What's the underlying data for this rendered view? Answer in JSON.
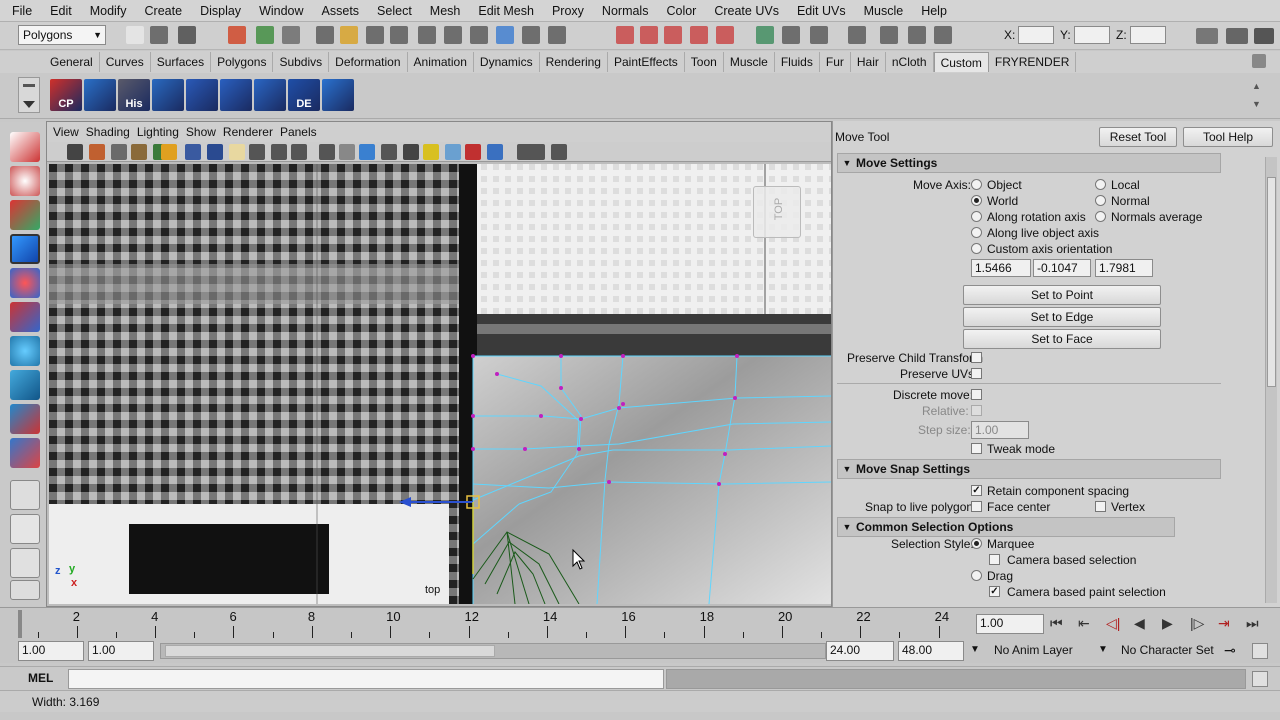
{
  "menus": [
    "File",
    "Edit",
    "Modify",
    "Create",
    "Display",
    "Window",
    "Assets",
    "Select",
    "Mesh",
    "Edit Mesh",
    "Proxy",
    "Normals",
    "Color",
    "Create UVs",
    "Edit UVs",
    "Muscle",
    "Help"
  ],
  "status_line": {
    "menu_set": "Polygons",
    "x_label": "X:",
    "y_label": "Y:",
    "z_label": "Z:"
  },
  "shelf_tabs": [
    "General",
    "Curves",
    "Surfaces",
    "Polygons",
    "Subdivs",
    "Deformation",
    "Animation",
    "Dynamics",
    "Rendering",
    "PaintEffects",
    "Toon",
    "Muscle",
    "Fluids",
    "Fur",
    "Hair",
    "nCloth",
    "Custom",
    "FRYRENDER"
  ],
  "shelf_active_tab": "Custom",
  "shelf_buttons": [
    {
      "label": "CP",
      "color": "#d0302a"
    },
    {
      "label": "",
      "color": "#2a70c8"
    },
    {
      "label": "His",
      "color": "#5a5a6a"
    },
    {
      "label": "",
      "color": "#2a6ac0"
    },
    {
      "label": "",
      "color": "#2a5ab8"
    },
    {
      "label": "",
      "color": "#2a60c0"
    },
    {
      "label": "",
      "color": "#2a66c4"
    },
    {
      "label": "DE",
      "color": "#1f4fa8"
    },
    {
      "label": "",
      "color": "#2a72d0"
    }
  ],
  "viewport": {
    "menus": [
      "View",
      "Shading",
      "Lighting",
      "Show",
      "Renderer",
      "Panels"
    ],
    "camera_label": "top",
    "view_cube_label": "TOP",
    "axis_z": "z",
    "axis_y": "y",
    "axis_x": "x"
  },
  "tool_settings": {
    "title": "Move Tool",
    "reset_button": "Reset Tool",
    "help_button": "Tool Help",
    "move_settings": {
      "header": "Move Settings",
      "move_axis_label": "Move Axis:",
      "options_left": [
        "Object",
        "World",
        "Along rotation axis",
        "Along live object axis",
        "Custom axis orientation"
      ],
      "options_right": [
        "Local",
        "Normal",
        "Normals average"
      ],
      "selected": "World",
      "values": [
        "1.5466",
        "-0.1047",
        "1.7981"
      ],
      "set_to_point": "Set to Point",
      "set_to_edge": "Set to Edge",
      "set_to_face": "Set to Face",
      "preserve_child": "Preserve Child Transform",
      "preserve_uvs": "Preserve UVs",
      "discrete_move": "Discrete move:",
      "relative": "Relative:",
      "step_size_label": "Step size:",
      "step_size": "1.00",
      "tweak_mode": "Tweak mode"
    },
    "snap_settings": {
      "header": "Move Snap Settings",
      "retain_spacing": "Retain component spacing",
      "snap_label": "Snap to live polygon:",
      "face_center": "Face center",
      "vertex": "Vertex"
    },
    "selection_options": {
      "header": "Common Selection Options",
      "style_label": "Selection Style:",
      "marquee": "Marquee",
      "camera_based_selection": "Camera based selection",
      "drag": "Drag",
      "camera_based_paint": "Camera based paint selection"
    }
  },
  "time_slider": {
    "ticks": [
      "2",
      "4",
      "6",
      "8",
      "10",
      "12",
      "14",
      "16",
      "18",
      "20",
      "22",
      "24"
    ],
    "current_time": "1.00"
  },
  "range_slider": {
    "start": "1.00",
    "playback_start": "1.00",
    "playback_end": "24.00",
    "end": "48.00",
    "anim_layer": "No Anim Layer",
    "character_set": "No Character Set"
  },
  "command_line": {
    "label": "MEL"
  },
  "help_line": {
    "text": "Width:  3.169"
  }
}
